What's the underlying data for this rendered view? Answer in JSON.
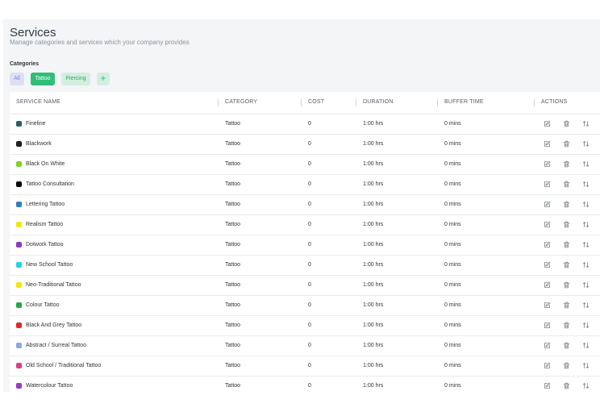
{
  "header": {
    "title": "Services",
    "subtitle": "Manage categories and services which your company provides"
  },
  "categories": {
    "label": "Categories",
    "items": [
      "All",
      "Tattoo",
      "Piercing"
    ],
    "add_label": "+"
  },
  "table": {
    "columns": [
      "SERVICE NAME",
      "CATEGORY",
      "COST",
      "DURATION",
      "BUFFER TIME",
      "ACTIONS"
    ],
    "rows": [
      {
        "name": "Fineline",
        "color": "#2e5f6b",
        "category": "Tattoo",
        "cost": "0",
        "duration": "1:00 hrs",
        "buffer": "0 mins"
      },
      {
        "name": "Blackwork",
        "color": "#1f1f1f",
        "category": "Tattoo",
        "cost": "0",
        "duration": "1:00 hrs",
        "buffer": "0 mins"
      },
      {
        "name": "Black On White",
        "color": "#7ed321",
        "category": "Tattoo",
        "cost": "0",
        "duration": "1:00 hrs",
        "buffer": "0 mins"
      },
      {
        "name": "Tattoo Consultation",
        "color": "#0a0a0a",
        "category": "Tattoo",
        "cost": "0",
        "duration": "1:00 hrs",
        "buffer": "0 mins"
      },
      {
        "name": "Lettering Tattoo",
        "color": "#2f7fc1",
        "category": "Tattoo",
        "cost": "0",
        "duration": "1:00 hrs",
        "buffer": "0 mins"
      },
      {
        "name": "Realism Tattoo",
        "color": "#f5e60a",
        "category": "Tattoo",
        "cost": "0",
        "duration": "1:00 hrs",
        "buffer": "0 mins"
      },
      {
        "name": "Dotwork Tattoo",
        "color": "#8e3bc4",
        "category": "Tattoo",
        "cost": "0",
        "duration": "1:00 hrs",
        "buffer": "0 mins"
      },
      {
        "name": "New School Tattoo",
        "color": "#22d3e6",
        "category": "Tattoo",
        "cost": "0",
        "duration": "1:00 hrs",
        "buffer": "0 mins"
      },
      {
        "name": "Neo-Traditional Tattoo",
        "color": "#f5e60a",
        "category": "Tattoo",
        "cost": "0",
        "duration": "1:00 hrs",
        "buffer": "0 mins"
      },
      {
        "name": "Colour Tattoo",
        "color": "#23a845",
        "category": "Tattoo",
        "cost": "0",
        "duration": "1:00 hrs",
        "buffer": "0 mins"
      },
      {
        "name": "Black And Grey Tattoo",
        "color": "#e0282e",
        "category": "Tattoo",
        "cost": "0",
        "duration": "1:00 hrs",
        "buffer": "0 mins"
      },
      {
        "name": "Abstract / Surreal Tattoo",
        "color": "#8ea6e0",
        "category": "Tattoo",
        "cost": "0",
        "duration": "1:00 hrs",
        "buffer": "0 mins"
      },
      {
        "name": "Old School / Traditional Tattoo",
        "color": "#e23c8c",
        "category": "Tattoo",
        "cost": "0",
        "duration": "1:00 hrs",
        "buffer": "0 mins"
      },
      {
        "name": "Watercolour Tattoo",
        "color": "#9b3bc0",
        "category": "Tattoo",
        "cost": "0",
        "duration": "1:00 hrs",
        "buffer": "0 mins"
      }
    ],
    "action_icons": [
      "edit-icon",
      "trash-icon",
      "sort-icon"
    ]
  },
  "colors": {
    "accent": "#2fbe78",
    "accent_light": "#d3efdf",
    "all_pill": "#dde0f3"
  }
}
